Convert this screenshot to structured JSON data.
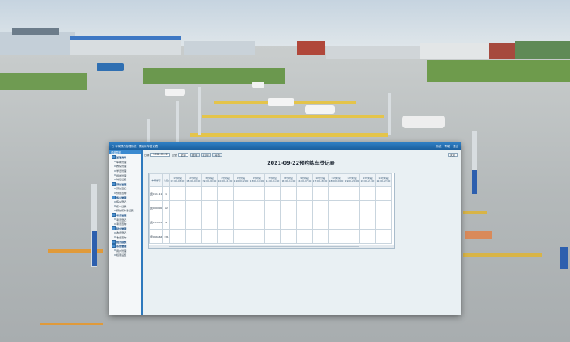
{
  "app": {
    "titlebar": {
      "left": "▢ 车辆预约管理系统",
      "center": "预约练车登记表",
      "right": [
        "系统",
        "帮助",
        "退出"
      ]
    },
    "sidebar": {
      "header": "菜单导航",
      "items": [
        {
          "label": "基础资料",
          "kind": "grp"
        },
        {
          "label": "车辆管理",
          "kind": "sub"
        },
        {
          "label": "教练管理",
          "kind": "sub"
        },
        {
          "label": "学员管理",
          "kind": "sub"
        },
        {
          "label": "场地管理",
          "kind": "sub"
        },
        {
          "label": "时段设置",
          "kind": "sub"
        },
        {
          "label": "预约管理",
          "kind": "grp"
        },
        {
          "label": "预约登记",
          "kind": "sub"
        },
        {
          "label": "预约查询",
          "kind": "sub"
        },
        {
          "label": "练车管理",
          "kind": "grp"
        },
        {
          "label": "练车登记",
          "kind": "sub"
        },
        {
          "label": "练车记录",
          "kind": "sub"
        },
        {
          "label": "预约练车登记表",
          "kind": "sub"
        },
        {
          "label": "考试管理",
          "kind": "grp"
        },
        {
          "label": "考试登记",
          "kind": "sub"
        },
        {
          "label": "考试查询",
          "kind": "sub"
        },
        {
          "label": "财务管理",
          "kind": "grp"
        },
        {
          "label": "收费登记",
          "kind": "sub"
        },
        {
          "label": "收费查询",
          "kind": "sub"
        },
        {
          "label": "统计报表",
          "kind": "grp"
        },
        {
          "label": "系统管理",
          "kind": "grp"
        },
        {
          "label": "用户管理",
          "kind": "sub"
        },
        {
          "label": "权限设置",
          "kind": "sub"
        }
      ]
    },
    "toolbar": {
      "date_label": "日期",
      "date_value": "2021-09-22",
      "type_label": "类型",
      "type_value": "全部",
      "query_label": "查询",
      "print_label": "打印",
      "export_label": "导出",
      "close_label": "关闭"
    },
    "report_title": "2021-09-22预约练车登记表",
    "grid": {
      "corner1": "车辆编号",
      "corner2": "次数",
      "slots": [
        {
          "l1": "1号时段",
          "l2": "07:00-08:00"
        },
        {
          "l1": "2号时段",
          "l2": "08:00-09:00"
        },
        {
          "l1": "3号时段",
          "l2": "09:00-10:00"
        },
        {
          "l1": "4号时段",
          "l2": "10:00-11:00"
        },
        {
          "l1": "5号时段",
          "l2": "11:00-12:00"
        },
        {
          "l1": "6号时段",
          "l2": "13:00-14:00"
        },
        {
          "l1": "7号时段",
          "l2": "14:00-15:00"
        },
        {
          "l1": "8号时段",
          "l2": "15:00-16:00"
        },
        {
          "l1": "9号时段",
          "l2": "16:00-17:00"
        },
        {
          "l1": "10号时段",
          "l2": "17:00-18:00"
        },
        {
          "l1": "11号时段",
          "l2": "18:00-19:00"
        },
        {
          "l1": "12号时段",
          "l2": "19:00-20:00"
        },
        {
          "l1": "13号时段",
          "l2": "20:00-21:00"
        },
        {
          "l1": "14号时段",
          "l2": "21:00-22:00"
        }
      ],
      "rows": [
        {
          "car": "冀G11111",
          "count": "1"
        },
        {
          "car": "冀G00000",
          "count": "12"
        },
        {
          "car": "冀G33333",
          "count": "4"
        },
        {
          "car": "冀G66666",
          "count": "131"
        }
      ]
    }
  }
}
